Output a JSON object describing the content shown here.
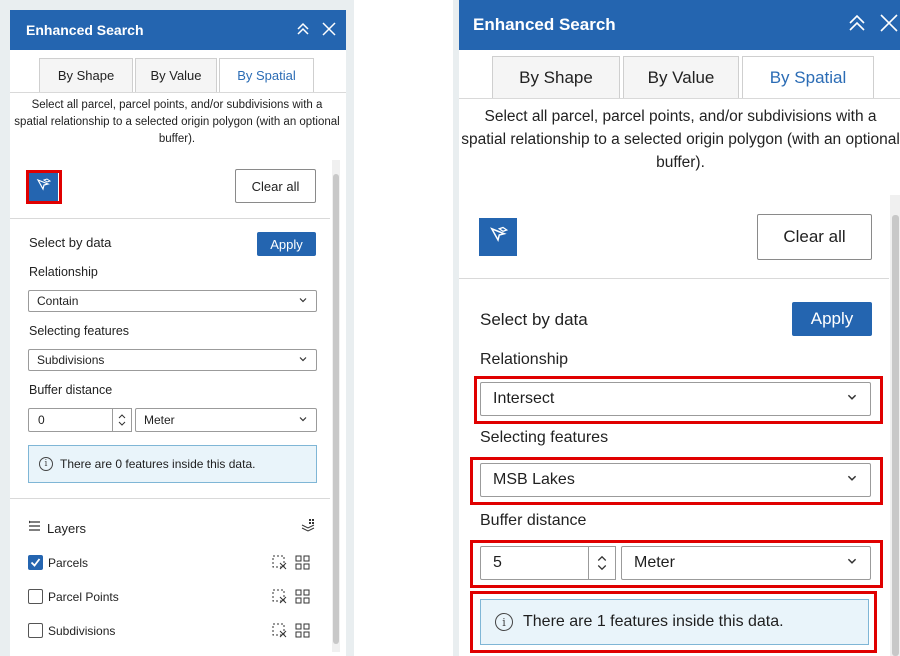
{
  "panel": {
    "title": "Enhanced Search",
    "tabs": [
      "By Shape",
      "By Value",
      "By Spatial"
    ],
    "active_tab": "By Spatial",
    "description": "Select all parcel, parcel points, and/or subdivisions with a spatial relationship to a selected origin polygon (with an optional buffer).",
    "clear_all": "Clear all",
    "select_by_data": "Select by data",
    "apply": "Apply",
    "relationship_label": "Relationship",
    "selecting_features_label": "Selecting features",
    "buffer_distance_label": "Buffer distance"
  },
  "left": {
    "relationship_value": "Contain",
    "selecting_features_value": "Subdivisions",
    "buffer_value": "0",
    "buffer_unit": "Meter",
    "info_text": "There are 0 features inside this data.",
    "layers_title": "Layers",
    "layers": [
      {
        "name": "Parcels",
        "checked": true
      },
      {
        "name": "Parcel Points",
        "checked": false
      },
      {
        "name": "Subdivisions",
        "checked": false
      }
    ]
  },
  "right": {
    "relationship_value": "Intersect",
    "selecting_features_value": "MSB Lakes",
    "buffer_value": "5",
    "buffer_unit": "Meter",
    "info_text": "There are 1 features inside this data."
  },
  "colors": {
    "header": "#2465b0",
    "highlight": "#e00000",
    "active_tab_text": "#2b6cb5",
    "info_bg": "#e9f4fa"
  },
  "icons": [
    "chevrons-up-icon",
    "close-icon",
    "select-tool-icon",
    "chevron-down-icon",
    "info-icon",
    "layers-list-icon",
    "layers-stack-icon",
    "clear-selection-icon",
    "grid-select-icon",
    "checkmark-icon"
  ]
}
